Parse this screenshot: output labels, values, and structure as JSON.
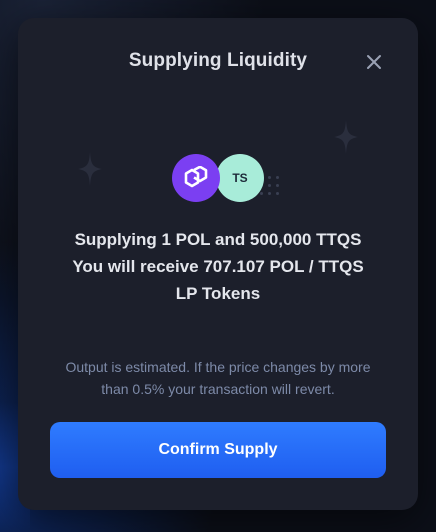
{
  "modal": {
    "title": "Supplying Liquidity",
    "close_icon": "close-icon"
  },
  "tokens": {
    "first": {
      "symbol": "POL",
      "icon": "polygon-logo-icon",
      "color": "#7b3ff2"
    },
    "second": {
      "label": "TS",
      "color": "#a8ecd9"
    }
  },
  "summary": {
    "line1": "Supplying 1 POL and 500,000 TTQS",
    "line2": "You will receive 707.107 POL / TTQS",
    "line3": "LP Tokens"
  },
  "note": {
    "line1": "Output is estimated. If the price changes by more",
    "line2": "than 0.5% your transaction will revert."
  },
  "actions": {
    "confirm_label": "Confirm Supply",
    "confirm_color": "#2f7cff"
  }
}
